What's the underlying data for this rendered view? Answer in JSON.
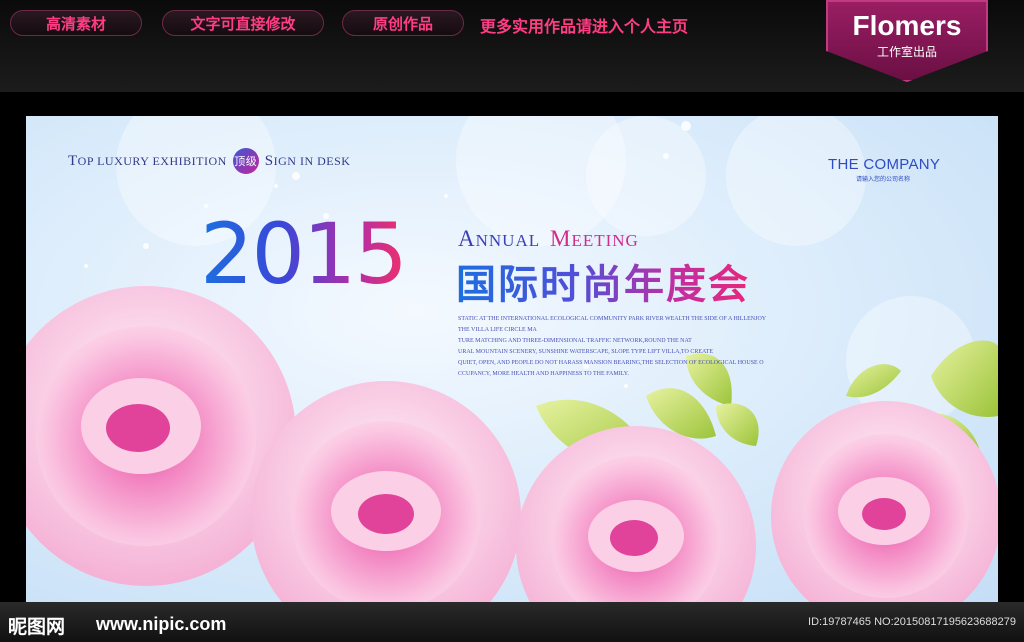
{
  "top_bar": {
    "buttons": [
      "高清素材",
      "文字可直接修改",
      "原创作品"
    ],
    "link_text": "更多实用作品请进入个人主页",
    "logo": {
      "name": "Flomers",
      "subtitle": "工作室出品"
    }
  },
  "banner": {
    "tagline": {
      "part1_cap": "T",
      "part1_rest": "OP LUXURY EXHIBITION",
      "badge": "顶级",
      "part2_cap": "S",
      "part2_rest": "IGN IN DESK"
    },
    "company": "THE COMPANY",
    "company_sub": "请输入您的公司名称",
    "year": "2015",
    "annual_cap": "A",
    "annual_rest": "NNUAL",
    "meeting_cap": "M",
    "meeting_rest": "EETING",
    "title_cn": "国际时尚年度会",
    "paragraph": [
      "STATIC AT THE INTERNATIONAL ECOLOGICAL COMMUNITY PARK RIVER WEALTH THE SIDE OF A HILLENJOY",
      "THE VILLA LIFE CIRCLE MA",
      "TURE MATCHING AND THREE-DIMENSIONAL TRAFFIC NETWORK,ROUND THE NAT",
      "URAL MOUNTAIN SCENERY, SUNSHINE WATERSCAPE, SLOPE TYPE LIFT VILLA,TO CREATE",
      "QUIET, OPEN, AND PEOPLE DO NOT HARASS MANSION BEARING,THE SELECTION OF ECOLOGICAL HOUSE O",
      "CCUPANCY, MORE HEALTH AND HAPPINESS TO THE FAMILY."
    ]
  },
  "footer": {
    "site_cn": "昵图网",
    "site_url": "www.nipic.com",
    "image_id": "ID:19787465 NO:20150817195623688279"
  },
  "colors": {
    "accent_pink": "#ff3d84",
    "logo_purple": "#8a1a58",
    "blue_text": "#2f4bc4",
    "rose": "#f47fbf"
  }
}
